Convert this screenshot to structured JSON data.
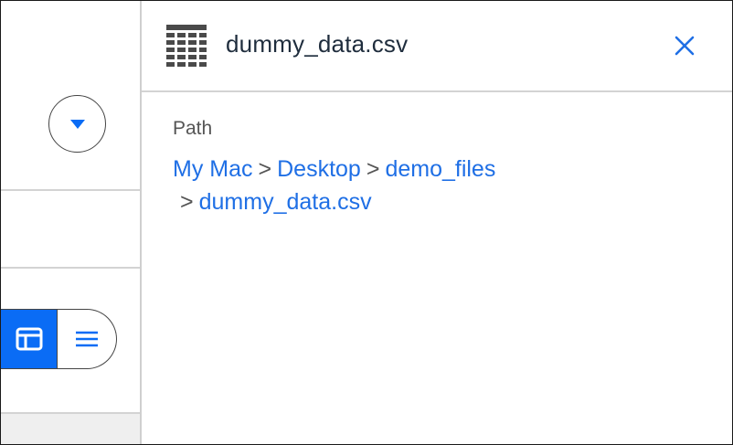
{
  "file_panel": {
    "title": "dummy_data.csv",
    "icon": "spreadsheet-icon",
    "close_icon": "close-icon"
  },
  "path": {
    "label": "Path",
    "separator": ">",
    "crumbs": [
      "My Mac",
      "Desktop",
      "demo_files",
      "dummy_data.csv"
    ]
  },
  "left_panel": {
    "dropdown_icon": "chevron-down-circle-icon",
    "view_toggle": {
      "grid_icon": "table-view-icon",
      "list_icon": "list-view-icon",
      "active": "grid"
    }
  },
  "colors": {
    "accent": "#0a6cf5",
    "link": "#1f6fe5",
    "border": "#d3d3d3",
    "title_text": "#1f2d3d"
  }
}
